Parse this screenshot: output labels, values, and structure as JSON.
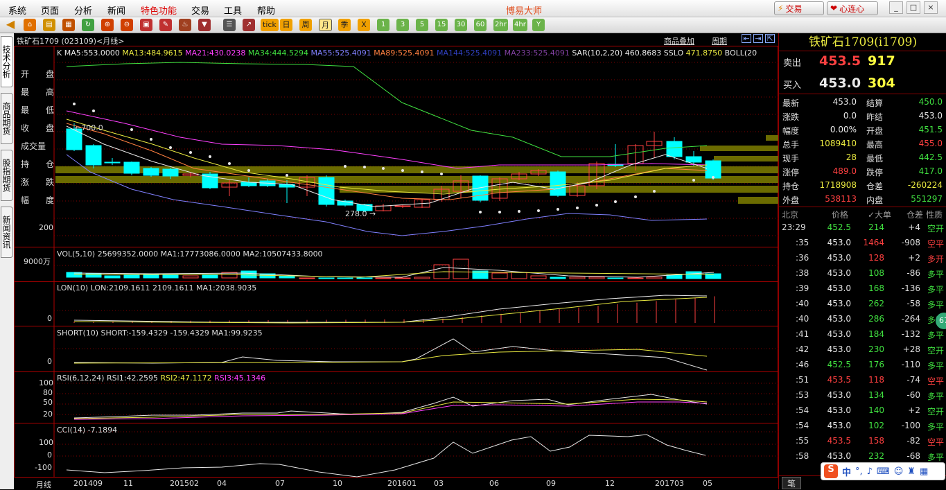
{
  "menu": {
    "items": [
      "系统",
      "页面",
      "分析",
      "新闻",
      "特色功能",
      "交易",
      "工具",
      "帮助"
    ],
    "title": "博易大师",
    "trade": "交易",
    "heart": "心连心",
    "win": [
      "_",
      "□",
      "×"
    ]
  },
  "toolbar": {
    "text_buttons": [
      "tick",
      "日",
      "周",
      "月",
      "季",
      "X"
    ],
    "num_buttons": [
      "1",
      "3",
      "5",
      "15",
      "30",
      "60",
      "2hr",
      "4hr",
      "Y"
    ],
    "active": "月"
  },
  "left_tabs": [
    "技术分析",
    "商品期货",
    "股指期货",
    "新闻资讯"
  ],
  "chart_header": {
    "title": "铁矿石1709 (023109)<月线>",
    "overlay": "商品叠加",
    "cycle": "周期"
  },
  "main_panel": {
    "k_label": "K",
    "ma": [
      {
        "t": "MA5:553.0000",
        "c": "#e8e8e8"
      },
      {
        "t": "MA13:484.9615",
        "c": "#e8e840"
      },
      {
        "t": "MA21:430.0238",
        "c": "#ff40ff"
      },
      {
        "t": "MA34:444.5294",
        "c": "#40e040"
      },
      {
        "t": "MA55:525.4091",
        "c": "#8080ff"
      },
      {
        "t": "MA89:525.4091",
        "c": "#ff8040"
      },
      {
        "t": "MA144:525.4091",
        "c": "#3040c0"
      },
      {
        "t": "MA233:525.4091",
        "c": "#8040a0"
      },
      {
        "t": "SAR(10,2,20)",
        "c": "#e8e8e8"
      },
      {
        "t": "460.8683",
        "c": "#e8e8e8"
      },
      {
        "t": "SSLO",
        "c": "#e8e8e8"
      },
      {
        "t": "471.8750",
        "c": "#e8e840"
      },
      {
        "t": "BOLL(20",
        "c": "#e8e8e8"
      }
    ],
    "info_labels": [
      "开",
      "盘",
      "最",
      "高",
      "最",
      "低",
      "收",
      "盘",
      "成交量",
      "持",
      "仓",
      "涨",
      "跌",
      "幅",
      "度"
    ],
    "high_mark": "←700.0",
    "low_mark": "278.0 →",
    "axis_200": "200"
  },
  "vol_panel": {
    "header": "VOL(5,10) 25699352.0000 MA1:17773086.0000 MA2:10507433.8000",
    "axis": "9000万"
  },
  "lon_panel": {
    "header": "LON(10) LON:2109.1611 2109.1611 MA1:2038.9035",
    "axis": "0"
  },
  "short_panel": {
    "header": "SHORT(10) SHORT:-159.4329 -159.4329 MA1:99.9235",
    "axis": "0"
  },
  "rsi_panel": {
    "header_a": "RSI(6,12,24)",
    "r1": "RSI1:42.2595",
    "r2": "RSI2:47.1172",
    "r3": "RSI3:45.1346",
    "axis": [
      "100",
      "80",
      "50",
      "20"
    ]
  },
  "cci_panel": {
    "header": "CCI(14) -7.1894",
    "axis": [
      "100",
      "0",
      "-100"
    ]
  },
  "x_axis": {
    "name": "月线",
    "labels": [
      "201409",
      "11",
      "201502",
      "04",
      "07",
      "10",
      "201601",
      "03",
      "06",
      "09",
      "12",
      "201703",
      "05"
    ]
  },
  "chart_data": {
    "type": "candlestick",
    "title": "铁矿石1709 (023109)<月线>",
    "x": [
      "201409",
      "201410",
      "201411",
      "201412",
      "201501",
      "201502",
      "201503",
      "201504",
      "201505",
      "201506",
      "201507",
      "201508",
      "201509",
      "201510",
      "201511",
      "201512",
      "201601",
      "201602",
      "201603",
      "201604",
      "201605",
      "201606",
      "201607",
      "201608",
      "201609",
      "201610",
      "201611",
      "201612",
      "201701",
      "201702",
      "201703",
      "201704",
      "201705"
    ],
    "high_label": 700.0,
    "low_label": 278.0,
    "axis_label": "200"
  },
  "quote": {
    "name": "铁矿石1709(i1709)",
    "sell_label": "卖出",
    "sell_price": "453.5",
    "sell_vol": "917",
    "buy_label": "买入",
    "buy_price": "453.0",
    "buy_vol": "304",
    "rows": [
      {
        "a": "最新",
        "av": "453.0",
        "ac": "#e8e8e8",
        "b": "结算",
        "bv": "450.0",
        "bc": "#40e040"
      },
      {
        "a": "涨跌",
        "av": "0.0",
        "ac": "#e8e8e8",
        "b": "昨结",
        "bv": "453.0",
        "bc": "#e8e8e8"
      },
      {
        "a": "幅度",
        "av": "0.00%",
        "ac": "#e8e8e8",
        "b": "开盘",
        "bv": "451.5",
        "bc": "#40e040"
      },
      {
        "a": "总手",
        "av": "1089410",
        "ac": "#e8e840",
        "b": "最高",
        "bv": "455.0",
        "bc": "#ff4040"
      },
      {
        "a": "现手",
        "av": "28",
        "ac": "#e8e840",
        "b": "最低",
        "bv": "442.5",
        "bc": "#40e040"
      },
      {
        "a": "涨停",
        "av": "489.0",
        "ac": "#ff4040",
        "b": "跌停",
        "bv": "417.0",
        "bc": "#40e040"
      },
      {
        "a": "持仓",
        "av": "1718908",
        "ac": "#e8e840",
        "b": "仓差",
        "bv": "-260224",
        "bc": "#e8e840"
      },
      {
        "a": "外盘",
        "av": "538113",
        "ac": "#ff4040",
        "b": "内盘",
        "bv": "551297",
        "bc": "#40e040"
      }
    ],
    "tick_header": [
      "北京",
      "价格",
      "✓大单",
      "仓差",
      "性质"
    ],
    "ticks": [
      {
        "t": "23:29",
        "p": "452.5",
        "pc": "#40e040",
        "v": "214",
        "vc": "#40e040",
        "d": "+4",
        "k": "空开",
        "kc": "#40e040"
      },
      {
        "t": ":35",
        "p": "453.0",
        "pc": "#e8e8e8",
        "v": "1464",
        "vc": "#ff4040",
        "d": "-908",
        "k": "空平",
        "kc": "#ff4040"
      },
      {
        "t": ":36",
        "p": "453.0",
        "pc": "#e8e8e8",
        "v": "128",
        "vc": "#ff4040",
        "d": "+2",
        "k": "多开",
        "kc": "#ff4040"
      },
      {
        "t": ":38",
        "p": "453.0",
        "pc": "#e8e8e8",
        "v": "108",
        "vc": "#40e040",
        "d": "-86",
        "k": "多平",
        "kc": "#40e040"
      },
      {
        "t": ":39",
        "p": "453.0",
        "pc": "#e8e8e8",
        "v": "168",
        "vc": "#40e040",
        "d": "-136",
        "k": "多平",
        "kc": "#40e040"
      },
      {
        "t": ":40",
        "p": "453.0",
        "pc": "#e8e8e8",
        "v": "262",
        "vc": "#40e040",
        "d": "-58",
        "k": "多平",
        "kc": "#40e040"
      },
      {
        "t": ":40",
        "p": "453.0",
        "pc": "#e8e8e8",
        "v": "286",
        "vc": "#40e040",
        "d": "-264",
        "k": "多平",
        "kc": "#40e040"
      },
      {
        "t": ":41",
        "p": "453.0",
        "pc": "#e8e8e8",
        "v": "184",
        "vc": "#40e040",
        "d": "-132",
        "k": "多平",
        "kc": "#40e040"
      },
      {
        "t": ":42",
        "p": "453.0",
        "pc": "#e8e8e8",
        "v": "230",
        "vc": "#40e040",
        "d": "+28",
        "k": "空开",
        "kc": "#40e040"
      },
      {
        "t": ":46",
        "p": "452.5",
        "pc": "#40e040",
        "v": "176",
        "vc": "#40e040",
        "d": "-110",
        "k": "多平",
        "kc": "#40e040"
      },
      {
        "t": ":51",
        "p": "453.5",
        "pc": "#ff4040",
        "v": "118",
        "vc": "#ff4040",
        "d": "-74",
        "k": "空平",
        "kc": "#ff4040"
      },
      {
        "t": ":53",
        "p": "453.0",
        "pc": "#e8e8e8",
        "v": "134",
        "vc": "#40e040",
        "d": "-60",
        "k": "多平",
        "kc": "#40e040"
      },
      {
        "t": ":54",
        "p": "453.0",
        "pc": "#e8e8e8",
        "v": "140",
        "vc": "#40e040",
        "d": "+2",
        "k": "空开",
        "kc": "#40e040"
      },
      {
        "t": ":54",
        "p": "453.0",
        "pc": "#e8e8e8",
        "v": "102",
        "vc": "#40e040",
        "d": "-100",
        "k": "多平",
        "kc": "#40e040"
      },
      {
        "t": ":55",
        "p": "453.5",
        "pc": "#ff4040",
        "v": "158",
        "vc": "#ff4040",
        "d": "-82",
        "k": "空平",
        "kc": "#ff4040"
      },
      {
        "t": ":58",
        "p": "453.0",
        "pc": "#e8e8e8",
        "v": "232",
        "vc": "#40e040",
        "d": "-68",
        "k": "多平",
        "kc": "#40e040"
      }
    ],
    "bottom_tab": "笔",
    "ime": "中",
    "badge": "67"
  },
  "colors": {
    "up": "#ff4040",
    "down": "#00ffff",
    "grid": "#800000",
    "panel_border": "#b00000"
  }
}
